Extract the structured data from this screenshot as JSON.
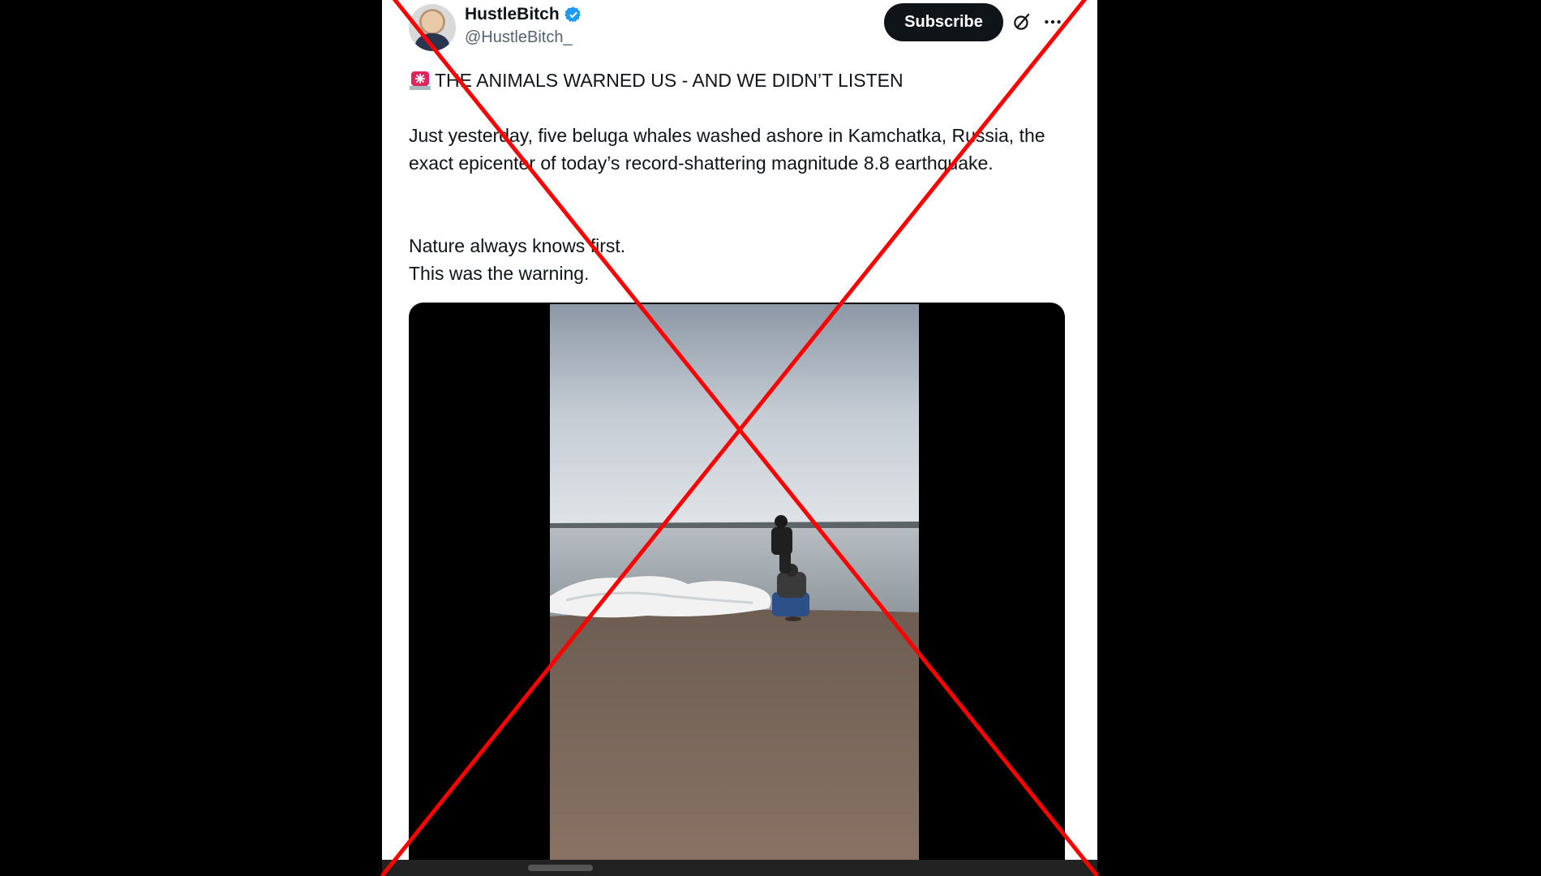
{
  "post": {
    "display_name": "HustleBitch",
    "handle": "@HustleBitch_",
    "subscribe_label": "Subscribe",
    "heading": "THE ANIMALS WARNED US - AND WE DIDN’T LISTEN",
    "paragraph1": "Just yesterday, five beluga whales washed ashore in Kamchatka, Russia, the exact epicenter of today’s record-shattering magnitude 8.8 earthquake.",
    "paragraph2_line1": "Nature always knows first.",
    "paragraph2_line2": "This was the warning."
  },
  "icons": {
    "verified": "verified-badge-icon",
    "grok": "grok-icon",
    "more": "more-options-icon",
    "siren": "siren-emoji-icon"
  },
  "colors": {
    "cross": "#ff0000",
    "verified": "#1d9bf0",
    "subscribe_bg": "#0f1419"
  }
}
